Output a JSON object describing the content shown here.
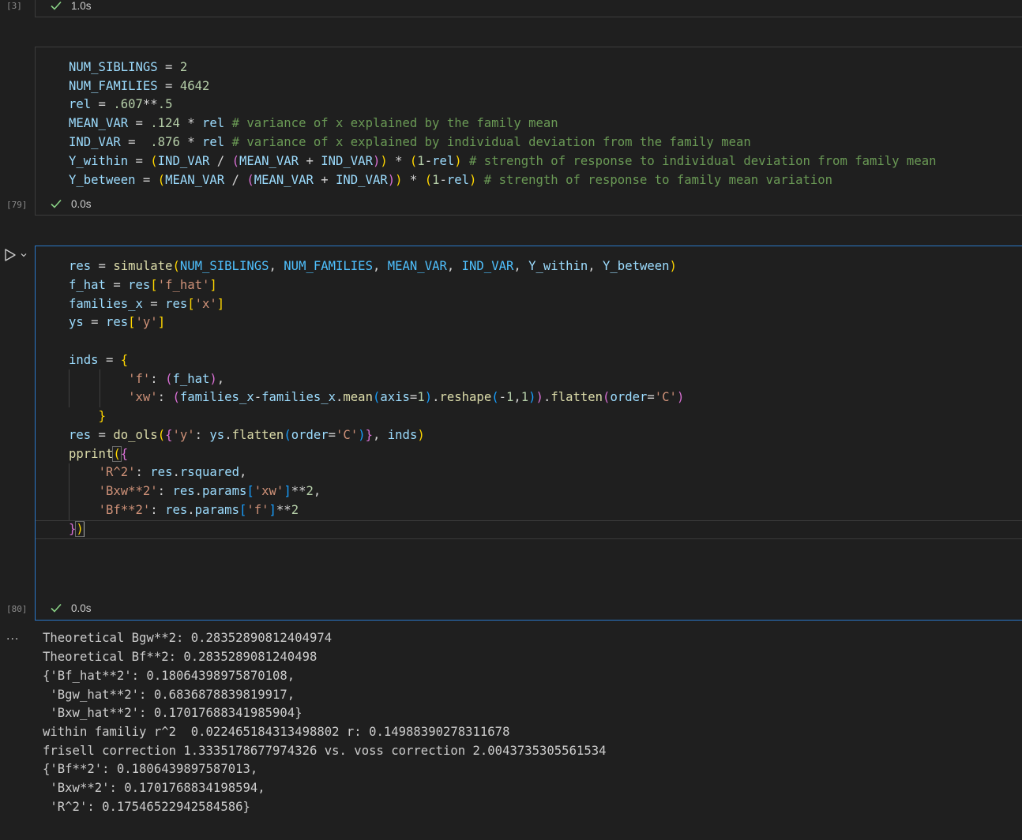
{
  "colors": {
    "background": "#1f1f1f",
    "active_border": "#2a78c9",
    "success_check": "#89d185"
  },
  "cell1": {
    "exec_count": "[3]",
    "duration": "1.0s"
  },
  "cell2": {
    "exec_count": "[79]",
    "duration": "0.0s",
    "code": [
      "NUM_SIBLINGS = 2",
      "NUM_FAMILIES = 4642",
      "rel = .607**.5",
      "MEAN_VAR = .124 * rel # variance of x explained by the family mean",
      "IND_VAR =  .876 * rel # variance of x explained by individual deviation from the family mean",
      "Y_within = (IND_VAR / (MEAN_VAR + IND_VAR)) * (1-rel) # strength of response to individual deviation from family mean",
      "Y_between = (MEAN_VAR / (MEAN_VAR + IND_VAR)) * (1-rel) # strength of response to family mean variation"
    ]
  },
  "cell3": {
    "exec_count": "[80]",
    "duration": "0.0s",
    "code": [
      "res = simulate(NUM_SIBLINGS, NUM_FAMILIES, MEAN_VAR, IND_VAR, Y_within, Y_between)",
      "f_hat = res['f_hat']",
      "families_x = res['x']",
      "ys = res['y']",
      "",
      "inds = {",
      "        'f': (f_hat),",
      "        'xw': (families_x-families_x.mean(axis=1).reshape(-1,1)).flatten(order='C')",
      "    }",
      "res = do_ols({'y': ys.flatten(order='C')}, inds)",
      "pprint({",
      "    'R^2': res.rsquared,",
      "    'Bxw**2': res.params['xw']**2,",
      "    'Bf**2': res.params['f']**2",
      "})"
    ],
    "output_marker": "...",
    "output": [
      "Theoretical Bgw**2: 0.28352890812404974",
      "Theoretical Bf**2: 0.2835289081240498",
      "{'Bf_hat**2': 0.18064398975870108,",
      " 'Bgw_hat**2': 0.6836878839819917,",
      " 'Bxw_hat**2': 0.17017688341985904}",
      "within familiy r^2  0.022465184313498802 r: 0.14988390278311678",
      "frisell correction 1.3335178677974326 vs. voss correction 2.0043735305561534",
      "{'Bf**2': 0.1806439897587013,",
      " 'Bxw**2': 0.1701768834198594,",
      " 'R^2': 0.17546522942584586}"
    ]
  }
}
